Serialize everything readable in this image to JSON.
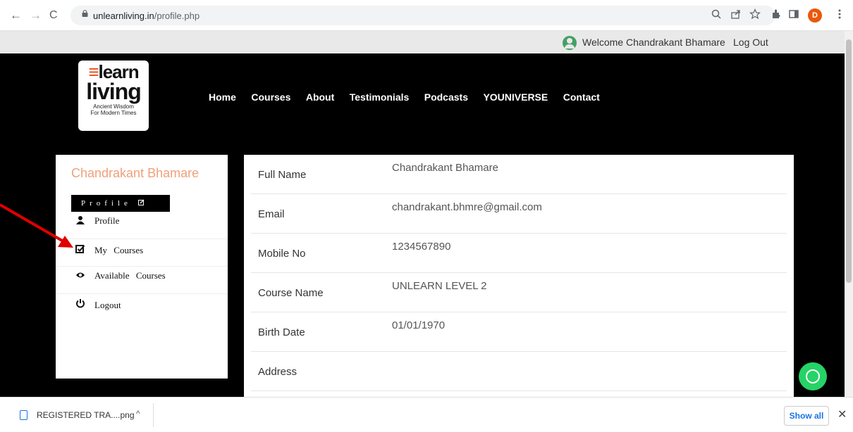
{
  "browser": {
    "url_host": "unlearnliving.in",
    "url_path": "/profile.php",
    "back_glyph": "←",
    "forward_glyph": "→",
    "reload_glyph": "C",
    "avatar_letter": "D",
    "icons": [
      "zoom-icon",
      "share-icon",
      "star-icon",
      "extensions-icon",
      "sidepanel-icon",
      "menu-icon"
    ]
  },
  "topbar": {
    "welcome": "Welcome Chandrakant Bhamare",
    "logout": "Log Out"
  },
  "logo": {
    "line1_mark": "≡",
    "line1": "learn",
    "line2": "living",
    "tagline1": "Ancient Wisdom",
    "tagline2": "For Modern Times"
  },
  "menu": [
    "Home",
    "Courses",
    "About",
    "Testimonials",
    "Podcasts",
    "YOUNIVERSE",
    "Contact"
  ],
  "sidebar": {
    "name": "Chandrakant Bhamare",
    "tag": "Profile",
    "items": [
      {
        "label": "Profile",
        "icon": "user-icon"
      },
      {
        "label": "My Courses",
        "icon": "checkbox-icon"
      },
      {
        "label": "Available Courses",
        "icon": "eye-icon"
      },
      {
        "label": "Logout",
        "icon": "power-icon"
      }
    ]
  },
  "profile": [
    {
      "key": "Full Name",
      "value": "Chandrakant Bhamare"
    },
    {
      "key": "Email",
      "value": "chandrakant.bhmre@gmail.com"
    },
    {
      "key": "Mobile No",
      "value": "1234567890"
    },
    {
      "key": "Course Name",
      "value": "UNLEARN LEVEL 2"
    },
    {
      "key": "Birth Date",
      "value": "01/01/1970"
    },
    {
      "key": "Address",
      "value": ""
    }
  ],
  "download": {
    "file": "REGISTERED TRA....png",
    "show_all": "Show all"
  },
  "colors": {
    "accent_name": "#f0a07a",
    "whatsapp": "#25d366",
    "arrow": "#e00000"
  }
}
